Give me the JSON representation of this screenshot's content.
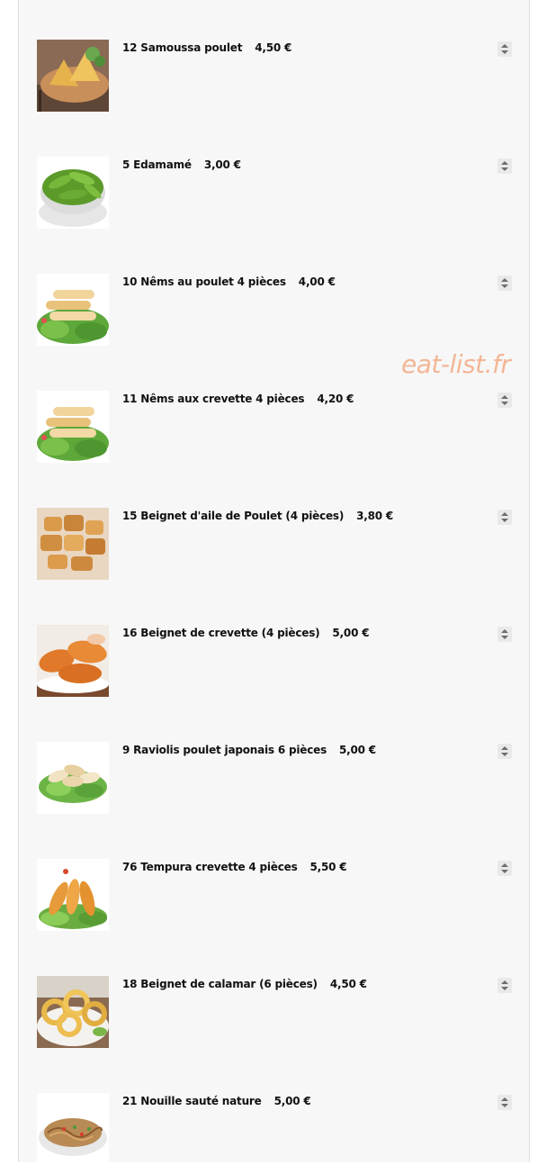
{
  "watermark": "eat-list.fr",
  "colors": {
    "panel_background": "#f7f7f7",
    "text": "#111111",
    "watermark": "#f3b695",
    "stepper": "#e9e9e9"
  },
  "items": [
    {
      "name": "12 Samoussa poulet",
      "price": "4,50 €",
      "image": "samosa-photo"
    },
    {
      "name": "5 Edamamé",
      "price": "3,00 €",
      "image": "edamame-photo"
    },
    {
      "name": "10 Nêms au poulet 4 pièces",
      "price": "4,00 €",
      "image": "nems-photo"
    },
    {
      "name": "11 Nêms aux crevette 4 pièces",
      "price": "4,20 €",
      "image": "nems-photo"
    },
    {
      "name": "15 Beignet d'aile de Poulet (4 pièces)",
      "price": "3,80 €",
      "image": "chicken-wings-photo"
    },
    {
      "name": "16 Beignet de crevette (4 pièces)",
      "price": "5,00 €",
      "image": "shrimp-fritter-photo"
    },
    {
      "name": "9 Raviolis poulet japonais 6 pièces",
      "price": "5,00 €",
      "image": "gyoza-photo"
    },
    {
      "name": "76 Tempura crevette 4 pièces",
      "price": "5,50 €",
      "image": "tempura-photo"
    },
    {
      "name": "18 Beignet de calamar (6 pièces)",
      "price": "4,50 €",
      "image": "calamari-photo"
    },
    {
      "name": "21 Nouille sauté nature",
      "price": "5,00 €",
      "image": "noodles-photo"
    }
  ]
}
